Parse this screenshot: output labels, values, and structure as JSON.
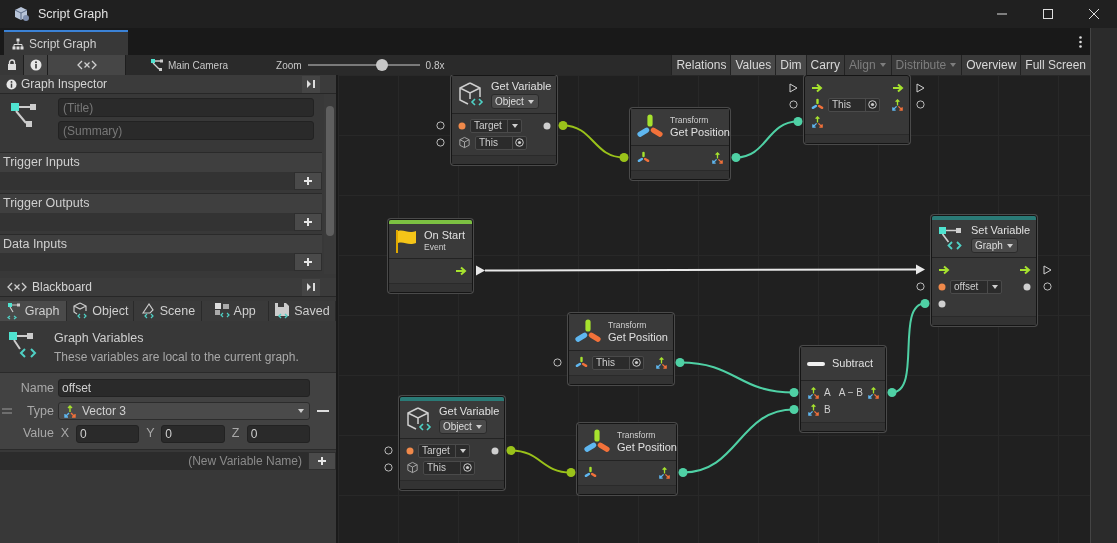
{
  "window": {
    "title": "Script Graph"
  },
  "tabs": [
    {
      "label": "Script Graph",
      "selected": true
    }
  ],
  "toolbar": {
    "toggles": [
      {
        "kind": "lock",
        "selected": false
      },
      {
        "kind": "info",
        "selected": true
      },
      {
        "kind": "variables",
        "selected": true
      }
    ],
    "target": "Main Camera",
    "zoom": {
      "label": "Zoom",
      "level": 0.66,
      "reading": "0.8x"
    },
    "buttons": [
      {
        "label": "Relations",
        "selected": false,
        "disabled": false,
        "dropdown": false
      },
      {
        "label": "Values",
        "selected": true,
        "disabled": false,
        "dropdown": false
      },
      {
        "label": "Dim",
        "selected": true,
        "disabled": false,
        "dropdown": false
      },
      {
        "label": "Carry",
        "selected": false,
        "disabled": false,
        "dropdown": false
      },
      {
        "label": "Align",
        "selected": false,
        "disabled": true,
        "dropdown": true
      },
      {
        "label": "Distribute",
        "selected": false,
        "disabled": true,
        "dropdown": true
      },
      {
        "label": "Overview",
        "selected": false,
        "disabled": false,
        "dropdown": false
      },
      {
        "label": "Full Screen",
        "selected": false,
        "disabled": false,
        "dropdown": false
      }
    ]
  },
  "inspector": {
    "title": "Graph Inspector",
    "title_placeholder": "(Title)",
    "summary_placeholder": "(Summary)",
    "sections": [
      {
        "label": "Trigger Inputs"
      },
      {
        "label": "Trigger Outputs"
      },
      {
        "label": "Data Inputs"
      }
    ]
  },
  "blackboard": {
    "title": "Blackboard",
    "tabs": [
      {
        "kind": "graph",
        "label": "Graph",
        "selected": true
      },
      {
        "kind": "object",
        "label": "Object",
        "selected": false
      },
      {
        "kind": "scene",
        "label": "Scene",
        "selected": false
      },
      {
        "kind": "app",
        "label": "App",
        "selected": false
      },
      {
        "kind": "saved",
        "label": "Saved",
        "selected": false
      }
    ],
    "heading": "Graph Variables",
    "description": "These variables are local to the current graph.",
    "variables": [
      {
        "name_label": "Name",
        "name": "offset",
        "type_label": "Type",
        "type": "Vector 3",
        "value_label": "Value",
        "components": [
          {
            "axis": "X",
            "value": "0"
          },
          {
            "axis": "Y",
            "value": "0"
          },
          {
            "axis": "Z",
            "value": "0"
          }
        ]
      }
    ],
    "new_variable_placeholder": "(New Variable Name)"
  },
  "graph": {
    "nodes": [
      {
        "kind": "get-variable",
        "title": "Get Variable",
        "scope": "Object",
        "fields": [
          "Target",
          "This"
        ]
      },
      {
        "kind": "get-position",
        "caption": "Transform",
        "title": "Get Position"
      },
      {
        "kind": "cut-off",
        "fields": [
          "This"
        ]
      },
      {
        "kind": "on-start",
        "color": "#7cc142",
        "title": "On Start",
        "caption": "Event"
      },
      {
        "kind": "set-variable",
        "color": "#2a7a76",
        "title": "Set Variable",
        "scope": "Graph",
        "fields": [
          "offset"
        ]
      },
      {
        "kind": "get-position",
        "caption": "Transform",
        "title": "Get Position",
        "fields": [
          "This"
        ]
      },
      {
        "kind": "subtract",
        "title": "Subtract",
        "labels": [
          "A",
          "A − B",
          "B"
        ]
      },
      {
        "kind": "get-variable",
        "color": "#2a7a76",
        "title": "Get Variable",
        "scope": "Object",
        "fields": [
          "Target",
          "This"
        ]
      },
      {
        "kind": "get-position",
        "caption": "Transform",
        "title": "Get Position"
      }
    ]
  }
}
